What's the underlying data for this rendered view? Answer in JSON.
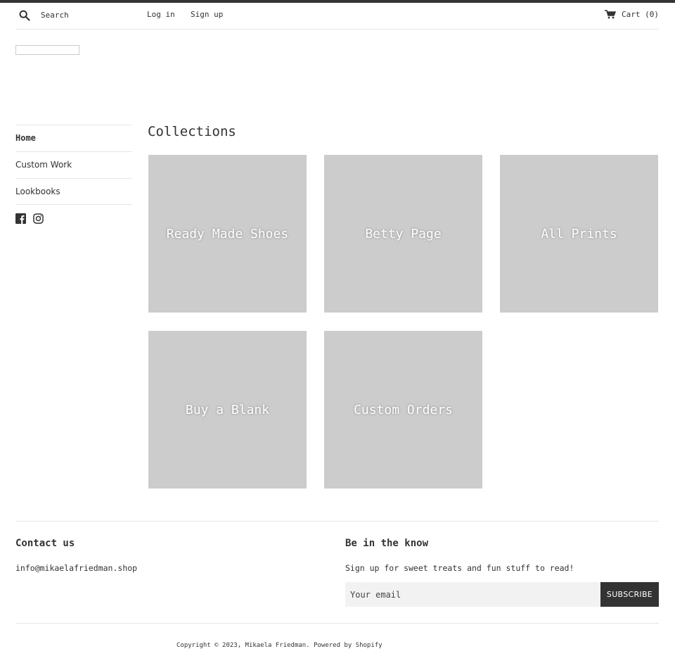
{
  "header": {
    "search_placeholder": "Search",
    "login_label": "Log in",
    "signup_label": "Sign up",
    "cart_label": "Cart (0)"
  },
  "sidebar": {
    "items": [
      {
        "label": "Home",
        "active": true
      },
      {
        "label": "Custom Work"
      },
      {
        "label": "Lookbooks"
      }
    ],
    "social": [
      "facebook-icon",
      "instagram-icon"
    ]
  },
  "main": {
    "title": "Collections",
    "collections": [
      {
        "label": "Ready Made Shoes"
      },
      {
        "label": "Betty Page"
      },
      {
        "label": "All Prints"
      },
      {
        "label": "Buy a Blank"
      },
      {
        "label": "Custom Orders"
      }
    ]
  },
  "footer": {
    "contact_heading": "Contact us",
    "contact_email": "info@mikaelafriedman.shop",
    "newsletter_heading": "Be in the know",
    "newsletter_text": "Sign up for sweet treats and fun stuff to read!",
    "email_placeholder": "Your email",
    "subscribe_label": "SUBSCRIBE",
    "copyright": "Copyright © 2023, Mikaela Friedman. Powered by Shopify"
  },
  "colors": {
    "accent": "#333333",
    "tile": "#cccccc",
    "input_bg": "#f2f2f2",
    "rule": "#e6e6e6"
  }
}
